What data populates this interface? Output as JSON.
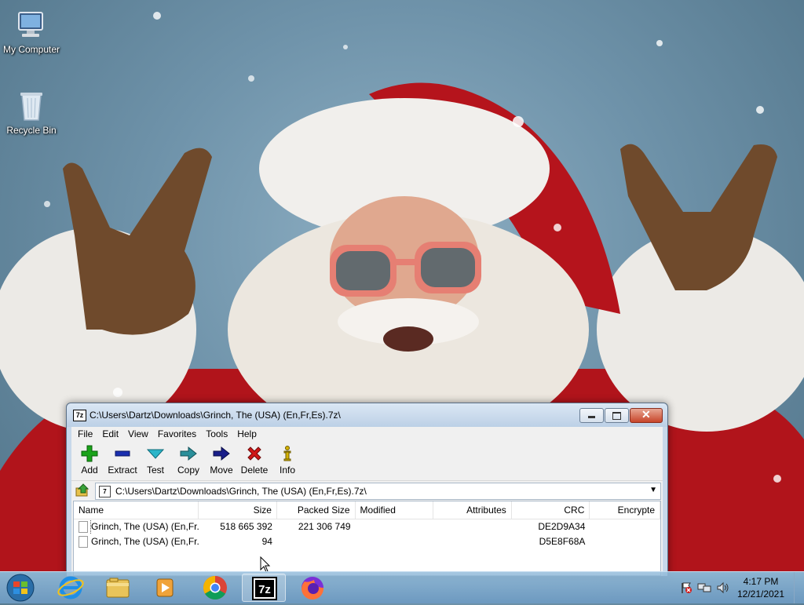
{
  "desktop": {
    "icons": [
      {
        "label": "My Computer"
      },
      {
        "label": "Recycle Bin"
      }
    ]
  },
  "window": {
    "title": "C:\\Users\\Dartz\\Downloads\\Grinch, The (USA) (En,Fr,Es).7z\\",
    "menu": [
      "File",
      "Edit",
      "View",
      "Favorites",
      "Tools",
      "Help"
    ],
    "toolbar": [
      {
        "label": "Add",
        "icon": "plus-icon",
        "color": "#1aa31a"
      },
      {
        "label": "Extract",
        "icon": "minus-icon",
        "color": "#1a2fb0"
      },
      {
        "label": "Test",
        "icon": "check-icon",
        "color": "#2bb5c9"
      },
      {
        "label": "Copy",
        "icon": "arrow-right-icon",
        "color": "#2a8f9a"
      },
      {
        "label": "Move",
        "icon": "arrow-right-icon",
        "color": "#1a1f8a"
      },
      {
        "label": "Delete",
        "icon": "x-icon",
        "color": "#d01818"
      },
      {
        "label": "Info",
        "icon": "info-icon",
        "color": "#d6b300"
      }
    ],
    "address": "C:\\Users\\Dartz\\Downloads\\Grinch, The (USA) (En,Fr,Es).7z\\",
    "columns": [
      "Name",
      "Size",
      "Packed Size",
      "Modified",
      "Attributes",
      "CRC",
      "Encrypte"
    ],
    "rows": [
      {
        "name": "Grinch, The (USA) (En,Fr...",
        "size": "518 665 392",
        "packed": "221 306 749",
        "modified": "",
        "attributes": "",
        "crc": "DE2D9A34",
        "encrypted": ""
      },
      {
        "name": "Grinch, The (USA) (En,Fr...",
        "size": "94",
        "packed": "",
        "modified": "",
        "attributes": "",
        "crc": "D5E8F68A",
        "encrypted": ""
      }
    ]
  },
  "taskbar": {
    "apps": [
      "internet-explorer-icon",
      "file-explorer-icon",
      "media-player-icon",
      "chrome-icon",
      "7zip-icon",
      "firefox-icon"
    ],
    "time": "4:17 PM",
    "date": "12/21/2021"
  }
}
